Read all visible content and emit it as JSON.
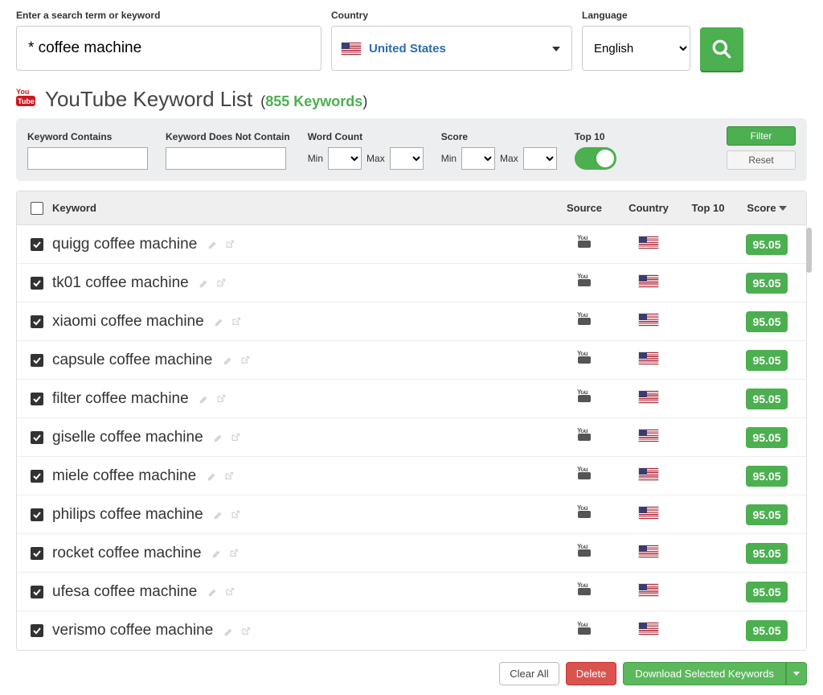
{
  "search": {
    "label": "Enter a search term or keyword",
    "value": "* coffee machine"
  },
  "country": {
    "label": "Country",
    "name": "United States"
  },
  "language": {
    "label": "Language",
    "value": "English"
  },
  "list": {
    "title": "YouTube Keyword List",
    "count_text": "855 Keywords"
  },
  "filters": {
    "contains_label": "Keyword Contains",
    "not_contain_label": "Keyword Does Not Contain",
    "word_count_label": "Word Count",
    "score_label": "Score",
    "min_text": "Min",
    "max_text": "Max",
    "top10_label": "Top 10",
    "filter_btn": "Filter",
    "reset_btn": "Reset"
  },
  "columns": {
    "keyword": "Keyword",
    "source": "Source",
    "country": "Country",
    "top10": "Top 10",
    "score": "Score"
  },
  "rows": [
    {
      "kw": "quigg coffee machine",
      "score": "95.05"
    },
    {
      "kw": "tk01 coffee machine",
      "score": "95.05"
    },
    {
      "kw": "xiaomi coffee machine",
      "score": "95.05"
    },
    {
      "kw": "capsule coffee machine",
      "score": "95.05"
    },
    {
      "kw": "filter coffee machine",
      "score": "95.05"
    },
    {
      "kw": "giselle coffee machine",
      "score": "95.05"
    },
    {
      "kw": "miele coffee machine",
      "score": "95.05"
    },
    {
      "kw": "philips coffee machine",
      "score": "95.05"
    },
    {
      "kw": "rocket coffee machine",
      "score": "95.05"
    },
    {
      "kw": "ufesa coffee machine",
      "score": "95.05"
    },
    {
      "kw": "verismo coffee machine",
      "score": "95.05"
    }
  ],
  "footer": {
    "clear_all": "Clear All",
    "delete": "Delete",
    "download": "Download Selected Keywords"
  }
}
